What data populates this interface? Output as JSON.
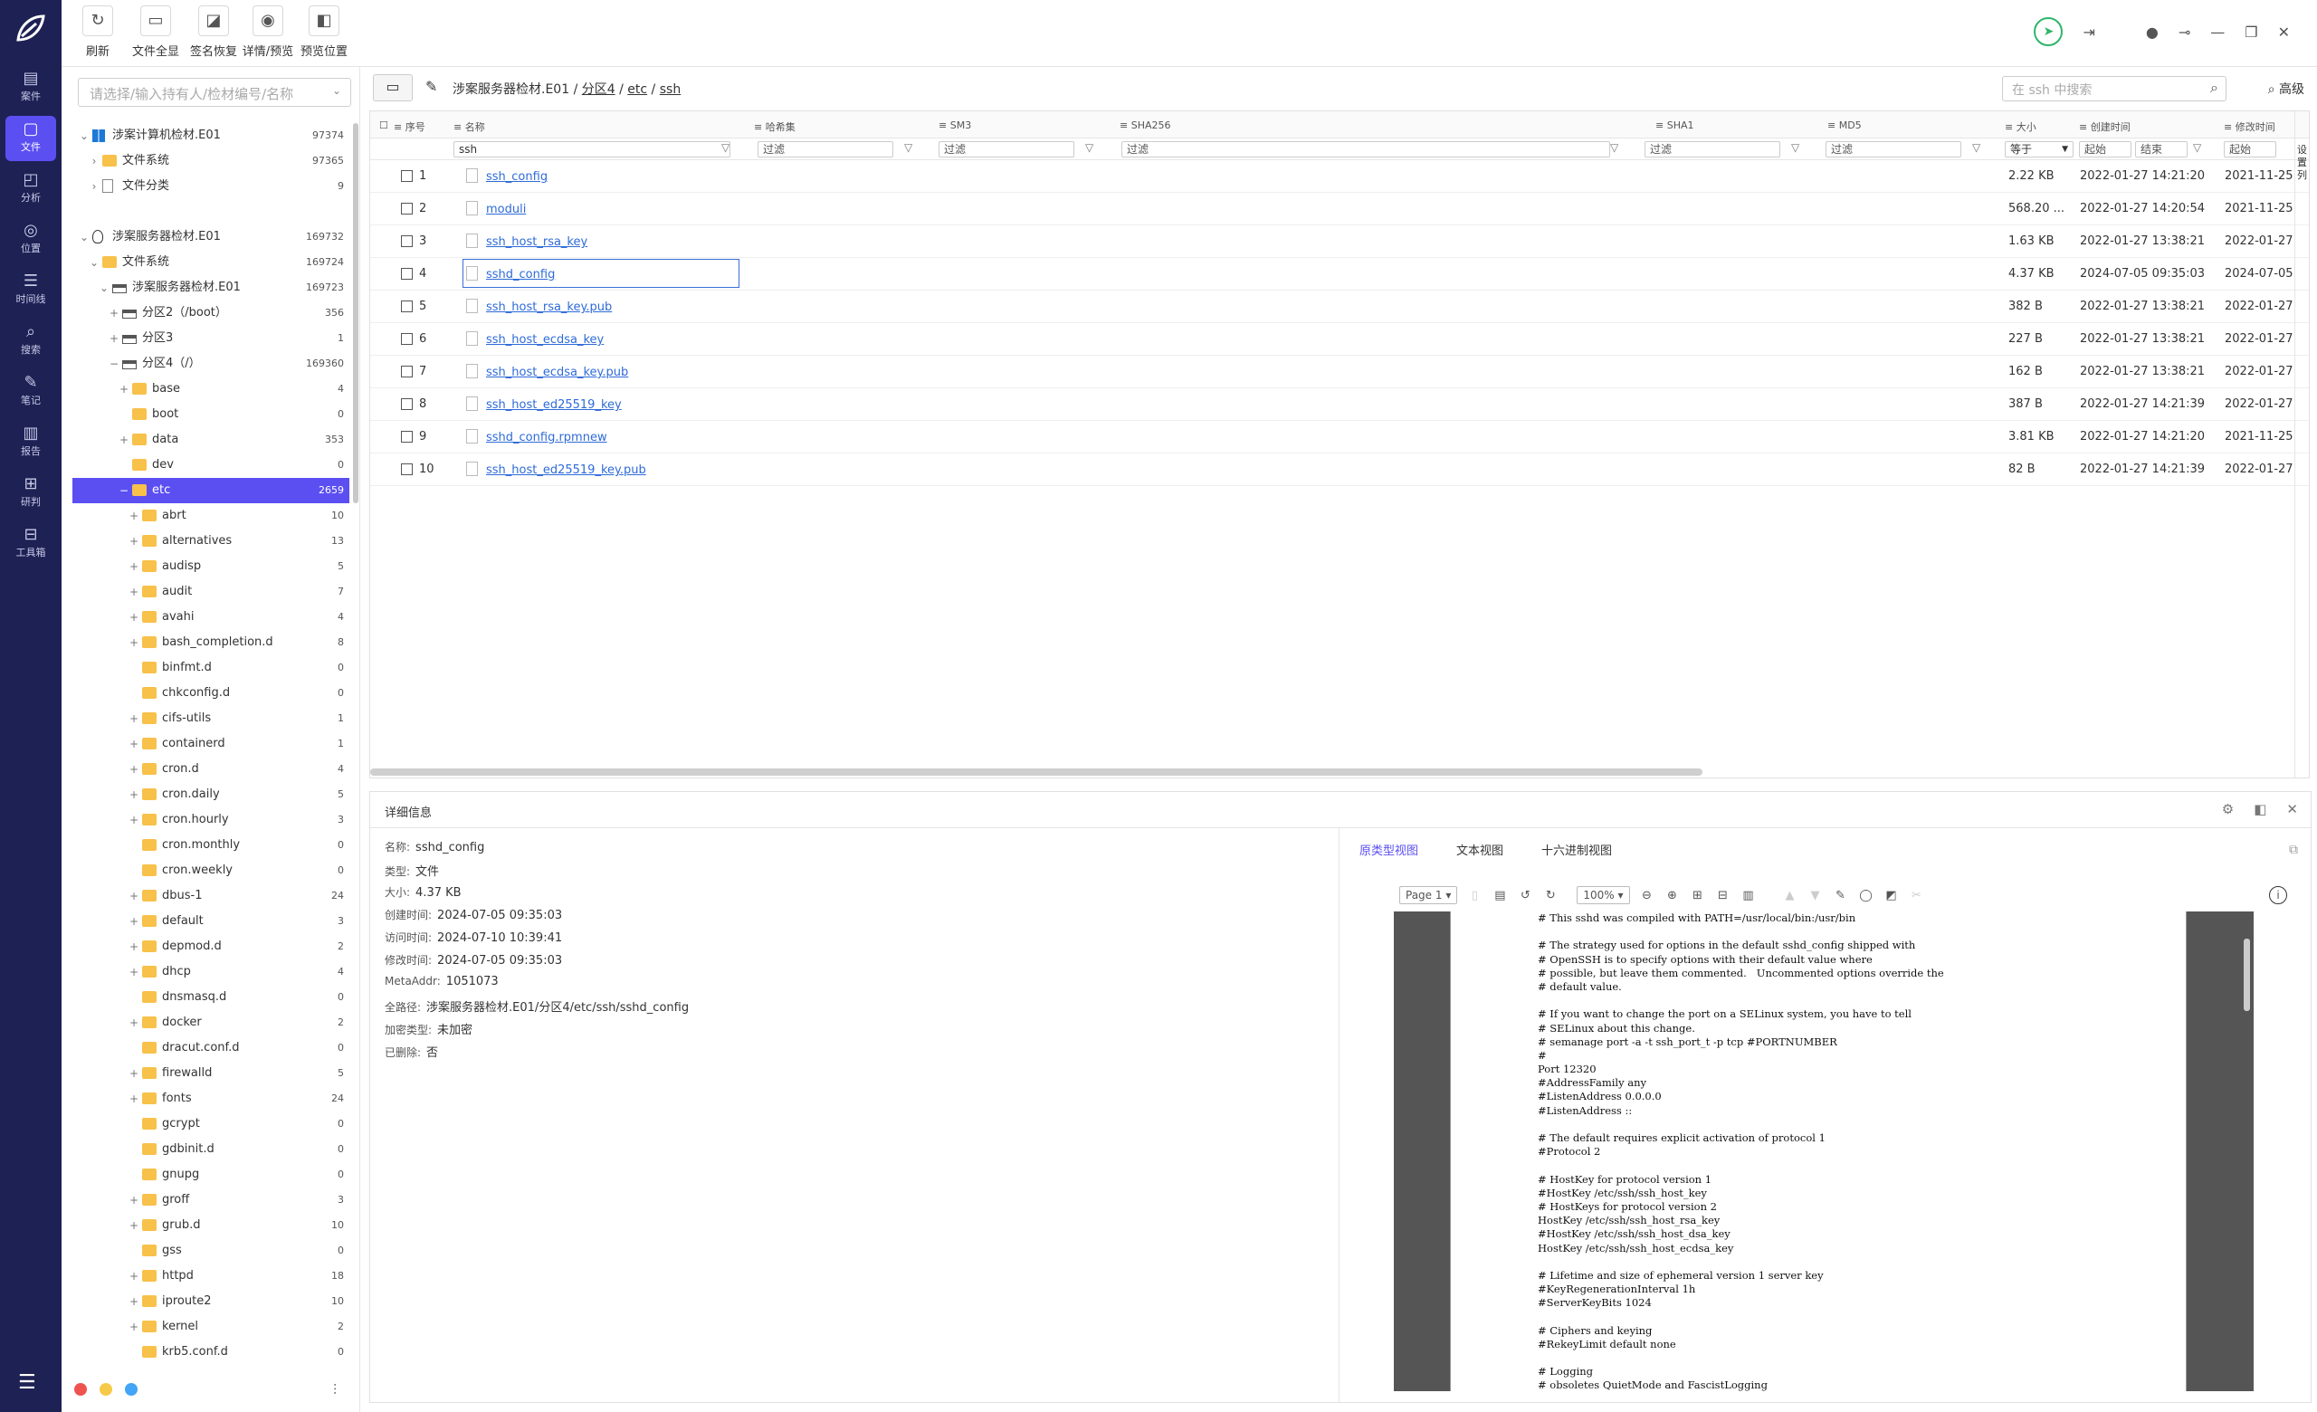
{
  "left_nav": {
    "items": [
      {
        "icon": "case-icon",
        "glyph": "▤",
        "label": "案件"
      },
      {
        "icon": "file-icon",
        "glyph": "▢",
        "label": "文件"
      },
      {
        "icon": "analysis-icon",
        "glyph": "◰",
        "label": "分析"
      },
      {
        "icon": "location-icon",
        "glyph": "◎",
        "label": "位置"
      },
      {
        "icon": "timeline-icon",
        "glyph": "☰",
        "label": "时间线"
      },
      {
        "icon": "search-icon",
        "glyph": "⌕",
        "label": "搜索"
      },
      {
        "icon": "note-icon",
        "glyph": "✎",
        "label": "笔记"
      },
      {
        "icon": "report-icon",
        "glyph": "▥",
        "label": "报告"
      },
      {
        "icon": "research-icon",
        "glyph": "⊞",
        "label": "研判"
      },
      {
        "icon": "toolbox-icon",
        "glyph": "⊟",
        "label": "工具箱"
      }
    ],
    "active_index": 1,
    "menu_glyph": "☰"
  },
  "toolbar": {
    "buttons": [
      {
        "icon": "refresh-icon",
        "glyph": "↻",
        "label": "刷新"
      },
      {
        "icon": "folder-view-icon",
        "glyph": "▭",
        "label": "文件全显"
      },
      {
        "icon": "signature-restore-icon",
        "glyph": "◪",
        "label": "签名恢复"
      },
      {
        "icon": "eye-hidden-icon",
        "glyph": "◉",
        "label": "详情/预览"
      },
      {
        "icon": "preview-position-icon",
        "glyph": "◧",
        "label": "预览位置"
      }
    ],
    "right_icons": [
      {
        "icon": "send-icon",
        "glyph": "➤"
      },
      {
        "icon": "export-icon",
        "glyph": "⇥"
      },
      {
        "icon": "user-icon",
        "glyph": "●"
      },
      {
        "icon": "pin-icon",
        "glyph": "⊸"
      },
      {
        "icon": "minimize-icon",
        "glyph": "—"
      },
      {
        "icon": "restore-icon",
        "glyph": "❐"
      },
      {
        "icon": "close-icon",
        "glyph": "✕"
      }
    ]
  },
  "tree": {
    "search_placeholder": "请选择/输入持有人/检材编号/名称",
    "nodes": [
      {
        "indent": 0,
        "exp": "⌄",
        "icon": "win",
        "label": "涉案计算机检材.E01",
        "count": "97374"
      },
      {
        "indent": 1,
        "exp": "›",
        "icon": "fold",
        "label": "文件系统",
        "count": "97365"
      },
      {
        "indent": 1,
        "exp": "›",
        "icon": "doc",
        "label": "文件分类",
        "count": "9"
      },
      {
        "indent": 0,
        "exp": "",
        "icon": "",
        "label": "",
        "count": ""
      },
      {
        "indent": 0,
        "exp": "⌄",
        "icon": "lnx",
        "label": "涉案服务器检材.E01",
        "count": "169732"
      },
      {
        "indent": 1,
        "exp": "⌄",
        "icon": "fold",
        "label": "文件系统",
        "count": "169724"
      },
      {
        "indent": 2,
        "exp": "⌄",
        "icon": "drv",
        "label": "涉案服务器检材.E01",
        "count": "169723"
      },
      {
        "indent": 3,
        "exp": "+",
        "icon": "drv",
        "label": "分区2（/boot）",
        "count": "356"
      },
      {
        "indent": 3,
        "exp": "+",
        "icon": "drv",
        "label": "分区3",
        "count": "1"
      },
      {
        "indent": 3,
        "exp": "−",
        "icon": "drv",
        "label": "分区4（/）",
        "count": "169360"
      },
      {
        "indent": 4,
        "exp": "+",
        "icon": "fold",
        "label": "base",
        "count": "4"
      },
      {
        "indent": 4,
        "exp": "",
        "icon": "fold",
        "label": "boot",
        "count": "0"
      },
      {
        "indent": 4,
        "exp": "+",
        "icon": "fold",
        "label": "data",
        "count": "353"
      },
      {
        "indent": 4,
        "exp": "",
        "icon": "fold",
        "label": "dev",
        "count": "0"
      },
      {
        "indent": 4,
        "exp": "−",
        "icon": "fold",
        "label": "etc",
        "count": "2659",
        "selected": true
      },
      {
        "indent": 5,
        "exp": "+",
        "icon": "fold",
        "label": "abrt",
        "count": "10"
      },
      {
        "indent": 5,
        "exp": "+",
        "icon": "fold",
        "label": "alternatives",
        "count": "13"
      },
      {
        "indent": 5,
        "exp": "+",
        "icon": "fold",
        "label": "audisp",
        "count": "5"
      },
      {
        "indent": 5,
        "exp": "+",
        "icon": "fold",
        "label": "audit",
        "count": "7"
      },
      {
        "indent": 5,
        "exp": "+",
        "icon": "fold",
        "label": "avahi",
        "count": "4"
      },
      {
        "indent": 5,
        "exp": "+",
        "icon": "fold",
        "label": "bash_completion.d",
        "count": "8"
      },
      {
        "indent": 5,
        "exp": "",
        "icon": "fold",
        "label": "binfmt.d",
        "count": "0"
      },
      {
        "indent": 5,
        "exp": "",
        "icon": "fold",
        "label": "chkconfig.d",
        "count": "0"
      },
      {
        "indent": 5,
        "exp": "+",
        "icon": "fold",
        "label": "cifs-utils",
        "count": "1"
      },
      {
        "indent": 5,
        "exp": "+",
        "icon": "fold",
        "label": "containerd",
        "count": "1"
      },
      {
        "indent": 5,
        "exp": "+",
        "icon": "fold",
        "label": "cron.d",
        "count": "4"
      },
      {
        "indent": 5,
        "exp": "+",
        "icon": "fold",
        "label": "cron.daily",
        "count": "5"
      },
      {
        "indent": 5,
        "exp": "+",
        "icon": "fold",
        "label": "cron.hourly",
        "count": "3"
      },
      {
        "indent": 5,
        "exp": "",
        "icon": "fold",
        "label": "cron.monthly",
        "count": "0"
      },
      {
        "indent": 5,
        "exp": "",
        "icon": "fold",
        "label": "cron.weekly",
        "count": "0"
      },
      {
        "indent": 5,
        "exp": "+",
        "icon": "fold",
        "label": "dbus-1",
        "count": "24"
      },
      {
        "indent": 5,
        "exp": "+",
        "icon": "fold",
        "label": "default",
        "count": "3"
      },
      {
        "indent": 5,
        "exp": "+",
        "icon": "fold",
        "label": "depmod.d",
        "count": "2"
      },
      {
        "indent": 5,
        "exp": "+",
        "icon": "fold",
        "label": "dhcp",
        "count": "4"
      },
      {
        "indent": 5,
        "exp": "",
        "icon": "fold",
        "label": "dnsmasq.d",
        "count": "0"
      },
      {
        "indent": 5,
        "exp": "+",
        "icon": "fold",
        "label": "docker",
        "count": "2"
      },
      {
        "indent": 5,
        "exp": "",
        "icon": "fold",
        "label": "dracut.conf.d",
        "count": "0"
      },
      {
        "indent": 5,
        "exp": "+",
        "icon": "fold",
        "label": "firewalld",
        "count": "5"
      },
      {
        "indent": 5,
        "exp": "+",
        "icon": "fold",
        "label": "fonts",
        "count": "24"
      },
      {
        "indent": 5,
        "exp": "",
        "icon": "fold",
        "label": "gcrypt",
        "count": "0"
      },
      {
        "indent": 5,
        "exp": "",
        "icon": "fold",
        "label": "gdbinit.d",
        "count": "0"
      },
      {
        "indent": 5,
        "exp": "",
        "icon": "fold",
        "label": "gnupg",
        "count": "0"
      },
      {
        "indent": 5,
        "exp": "+",
        "icon": "fold",
        "label": "groff",
        "count": "3"
      },
      {
        "indent": 5,
        "exp": "+",
        "icon": "fold",
        "label": "grub.d",
        "count": "10"
      },
      {
        "indent": 5,
        "exp": "",
        "icon": "fold",
        "label": "gss",
        "count": "0"
      },
      {
        "indent": 5,
        "exp": "+",
        "icon": "fold",
        "label": "httpd",
        "count": "18"
      },
      {
        "indent": 5,
        "exp": "+",
        "icon": "fold",
        "label": "iproute2",
        "count": "10"
      },
      {
        "indent": 5,
        "exp": "+",
        "icon": "fold",
        "label": "kernel",
        "count": "2"
      },
      {
        "indent": 5,
        "exp": "",
        "icon": "fold",
        "label": "krb5.conf.d",
        "count": "0"
      }
    ],
    "footer_dots": [
      "#ef5350",
      "#f7c948",
      "#42a5f5"
    ],
    "footer_icon_glyph": "⫶"
  },
  "breadcrumb": {
    "parts": [
      "涉案服务器检材.E01",
      "分区4",
      "etc",
      "ssh"
    ],
    "sep": " / "
  },
  "search": {
    "placeholder": "在 ssh 中搜索",
    "advanced_label": "高级"
  },
  "grid": {
    "headers": {
      "index": "序号",
      "name": "名称",
      "hashset": "哈希集",
      "sm3": "SM3",
      "sha256": "SHA256",
      "sha1": "SHA1",
      "md5": "MD5",
      "size": "大小",
      "ctime": "创建时间",
      "mtime": "修改时间"
    },
    "filters": {
      "name": "ssh",
      "placeholder": "过滤",
      "size_op": "等于",
      "start": "起始",
      "end": "结束",
      "start2": "起始"
    },
    "rows": [
      {
        "index": "1",
        "name": "ssh_config",
        "size": "2.22 KB",
        "ctime": "2022-01-27 14:21:20",
        "mtime": "2021-11-25"
      },
      {
        "index": "2",
        "name": "moduli",
        "size": "568.20 ...",
        "ctime": "2022-01-27 14:20:54",
        "mtime": "2021-11-25"
      },
      {
        "index": "3",
        "name": "ssh_host_rsa_key",
        "size": "1.63 KB",
        "ctime": "2022-01-27 13:38:21",
        "mtime": "2022-01-27"
      },
      {
        "index": "4",
        "name": "sshd_config",
        "size": "4.37 KB",
        "ctime": "2024-07-05 09:35:03",
        "mtime": "2024-07-05",
        "selected": true
      },
      {
        "index": "5",
        "name": "ssh_host_rsa_key.pub",
        "size": "382 B",
        "ctime": "2022-01-27 13:38:21",
        "mtime": "2022-01-27"
      },
      {
        "index": "6",
        "name": "ssh_host_ecdsa_key",
        "size": "227 B",
        "ctime": "2022-01-27 13:38:21",
        "mtime": "2022-01-27"
      },
      {
        "index": "7",
        "name": "ssh_host_ecdsa_key.pub",
        "size": "162 B",
        "ctime": "2022-01-27 13:38:21",
        "mtime": "2022-01-27"
      },
      {
        "index": "8",
        "name": "ssh_host_ed25519_key",
        "size": "387 B",
        "ctime": "2022-01-27 14:21:39",
        "mtime": "2022-01-27"
      },
      {
        "index": "9",
        "name": "sshd_config.rpmnew",
        "size": "3.81 KB",
        "ctime": "2022-01-27 14:21:20",
        "mtime": "2021-11-25"
      },
      {
        "index": "10",
        "name": "ssh_host_ed25519_key.pub",
        "size": "82 B",
        "ctime": "2022-01-27 14:21:39",
        "mtime": "2022-01-27"
      }
    ],
    "side_label": "设置列"
  },
  "detail": {
    "title": "详细信息",
    "props": [
      {
        "label": "名称:",
        "value": "sshd_config"
      },
      {
        "label": "类型:",
        "value": "文件"
      },
      {
        "label": "大小:",
        "value": "4.37 KB"
      },
      {
        "label": "创建时间:",
        "value": "2024-07-05 09:35:03"
      },
      {
        "label": "访问时间:",
        "value": "2024-07-10 10:39:41"
      },
      {
        "label": "修改时间:",
        "value": "2024-07-05 09:35:03"
      },
      {
        "label": "MetaAddr:",
        "value": "1051073"
      },
      {
        "label": "全路径:",
        "value": "涉案服务器检材.E01/分区4/etc/ssh/sshd_config"
      },
      {
        "label": "加密类型:",
        "value": "未加密"
      },
      {
        "label": "已删除:",
        "value": "否"
      }
    ],
    "tabs": [
      "原类型视图",
      "文本视图",
      "十六进制视图"
    ],
    "active_tab": 0,
    "pdf": {
      "page_label": "Page 1",
      "zoom": "100%"
    },
    "text_lines": [
      "# This sshd was compiled with PATH=/usr/local/bin:/usr/bin",
      "",
      "# The strategy used for options in the default sshd_config shipped with",
      "# OpenSSH is to specify options with their default value where",
      "# possible, but leave them commented.   Uncommented options override the",
      "# default value.",
      "",
      "# If you want to change the port on a SELinux system, you have to tell",
      "# SELinux about this change.",
      "# semanage port -a -t ssh_port_t -p tcp #PORTNUMBER",
      "#",
      "Port 12320",
      "#AddressFamily any",
      "#ListenAddress 0.0.0.0",
      "#ListenAddress ::",
      "",
      "# The default requires explicit activation of protocol 1",
      "#Protocol 2",
      "",
      "# HostKey for protocol version 1",
      "#HostKey /etc/ssh/ssh_host_key",
      "# HostKeys for protocol version 2",
      "HostKey /etc/ssh/ssh_host_rsa_key",
      "#HostKey /etc/ssh/ssh_host_dsa_key",
      "HostKey /etc/ssh/ssh_host_ecdsa_key",
      "",
      "# Lifetime and size of ephemeral version 1 server key",
      "#KeyRegenerationInterval 1h",
      "#ServerKeyBits 1024",
      "",
      "# Ciphers and keying",
      "#RekeyLimit default none",
      "",
      "# Logging",
      "# obsoletes QuietMode and FascistLogging"
    ]
  },
  "colors": {
    "sidebar": "#1e2154",
    "accent": "#5b4ff2",
    "link": "#2e6bd8"
  }
}
